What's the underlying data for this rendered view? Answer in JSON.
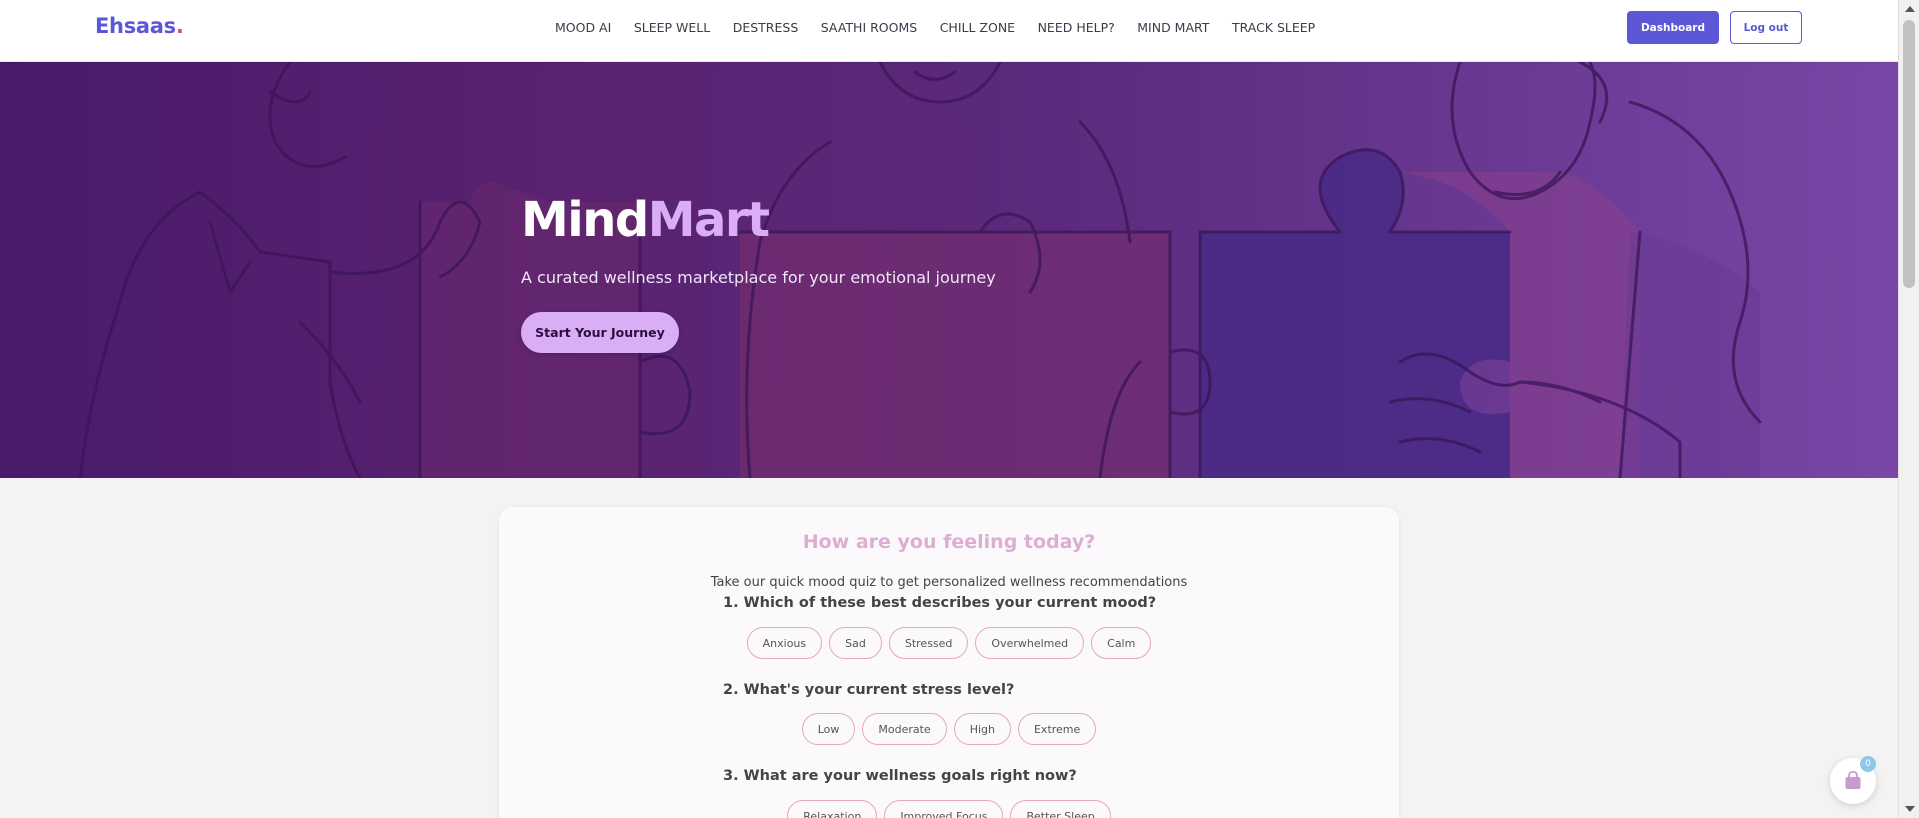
{
  "navbar": {
    "brand": "Ehsaas",
    "brand_dot": ".",
    "links": [
      "MOOD AI",
      "SLEEP WELL",
      "DESTRESS",
      "SAATHI ROOMS",
      "CHILL ZONE",
      "NEED HELP?",
      "MIND MART",
      "TRACK SLEEP"
    ],
    "dashboard_label": "Dashboard",
    "logout_label": "Log out"
  },
  "hero": {
    "title_main": "Mind",
    "title_accent": "Mart",
    "subtitle": "A curated wellness marketplace for your emotional journey",
    "cta_label": "Start Your Journey"
  },
  "quiz": {
    "title": "How are you feeling today?",
    "subtitle": "Take our quick mood quiz to get personalized wellness recommendations",
    "questions": [
      {
        "text": "1. Which of these best describes your current mood?",
        "options": [
          "Anxious",
          "Sad",
          "Stressed",
          "Overwhelmed",
          "Calm"
        ]
      },
      {
        "text": "2. What's your current stress level?",
        "options": [
          "Low",
          "Moderate",
          "High",
          "Extreme"
        ]
      },
      {
        "text": "3. What are your wellness goals right now?",
        "options": [
          "Relaxation",
          "Improved Focus",
          "Better Sleep"
        ]
      }
    ]
  },
  "cart": {
    "count": "0",
    "icon": "shopping-bag-icon"
  },
  "colors": {
    "brand": "#5b57d6",
    "brand_dot": "#e14b7a",
    "hero_accent": "#d9aef5",
    "quiz_title": "#dcaed2",
    "option_border": "#e7a8b8"
  }
}
